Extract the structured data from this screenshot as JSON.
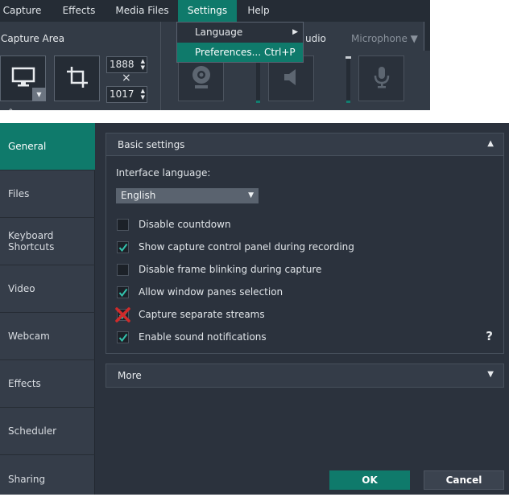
{
  "menubar": {
    "items": [
      "Capture",
      "Effects",
      "Media Files",
      "Settings",
      "Help"
    ],
    "active": "Settings"
  },
  "settings_menu": {
    "items": [
      {
        "label": "Language",
        "shortcut": "",
        "submenu": true
      },
      {
        "label": "Preferences...",
        "shortcut": "Ctrl+P",
        "submenu": false
      }
    ]
  },
  "capture_panel": {
    "label": "Capture Area",
    "width": "1888",
    "height": "1017",
    "times": "×",
    "audio_partial_label": "udio",
    "microphone_label": "Microphone ▼"
  },
  "preferences": {
    "sidebar": [
      "General",
      "Files",
      "Keyboard Shortcuts",
      "Video",
      "Webcam",
      "Effects",
      "Scheduler",
      "Sharing"
    ],
    "active_tab": "General",
    "basic_settings": {
      "title": "Basic settings",
      "interface_language_label": "Interface language:",
      "interface_language_value": "English",
      "options": [
        {
          "label": "Disable countdown",
          "state": "unchecked"
        },
        {
          "label": "Show capture control panel during recording",
          "state": "checked"
        },
        {
          "label": "Disable frame blinking during capture",
          "state": "unchecked"
        },
        {
          "label": "Allow window panes selection",
          "state": "checked"
        },
        {
          "label": "Capture separate streams",
          "state": "crossed"
        },
        {
          "label": "Enable sound notifications",
          "state": "checked"
        }
      ],
      "help": "?"
    },
    "more": {
      "title": "More"
    },
    "buttons": {
      "ok": "OK",
      "cancel": "Cancel"
    }
  },
  "colors": {
    "accent": "#0f7a6b",
    "panel_bg": "#2b323d",
    "sidebar_bg": "#353d49",
    "menubar_bg": "#252c35",
    "cross_mark": "#d12a2a"
  }
}
